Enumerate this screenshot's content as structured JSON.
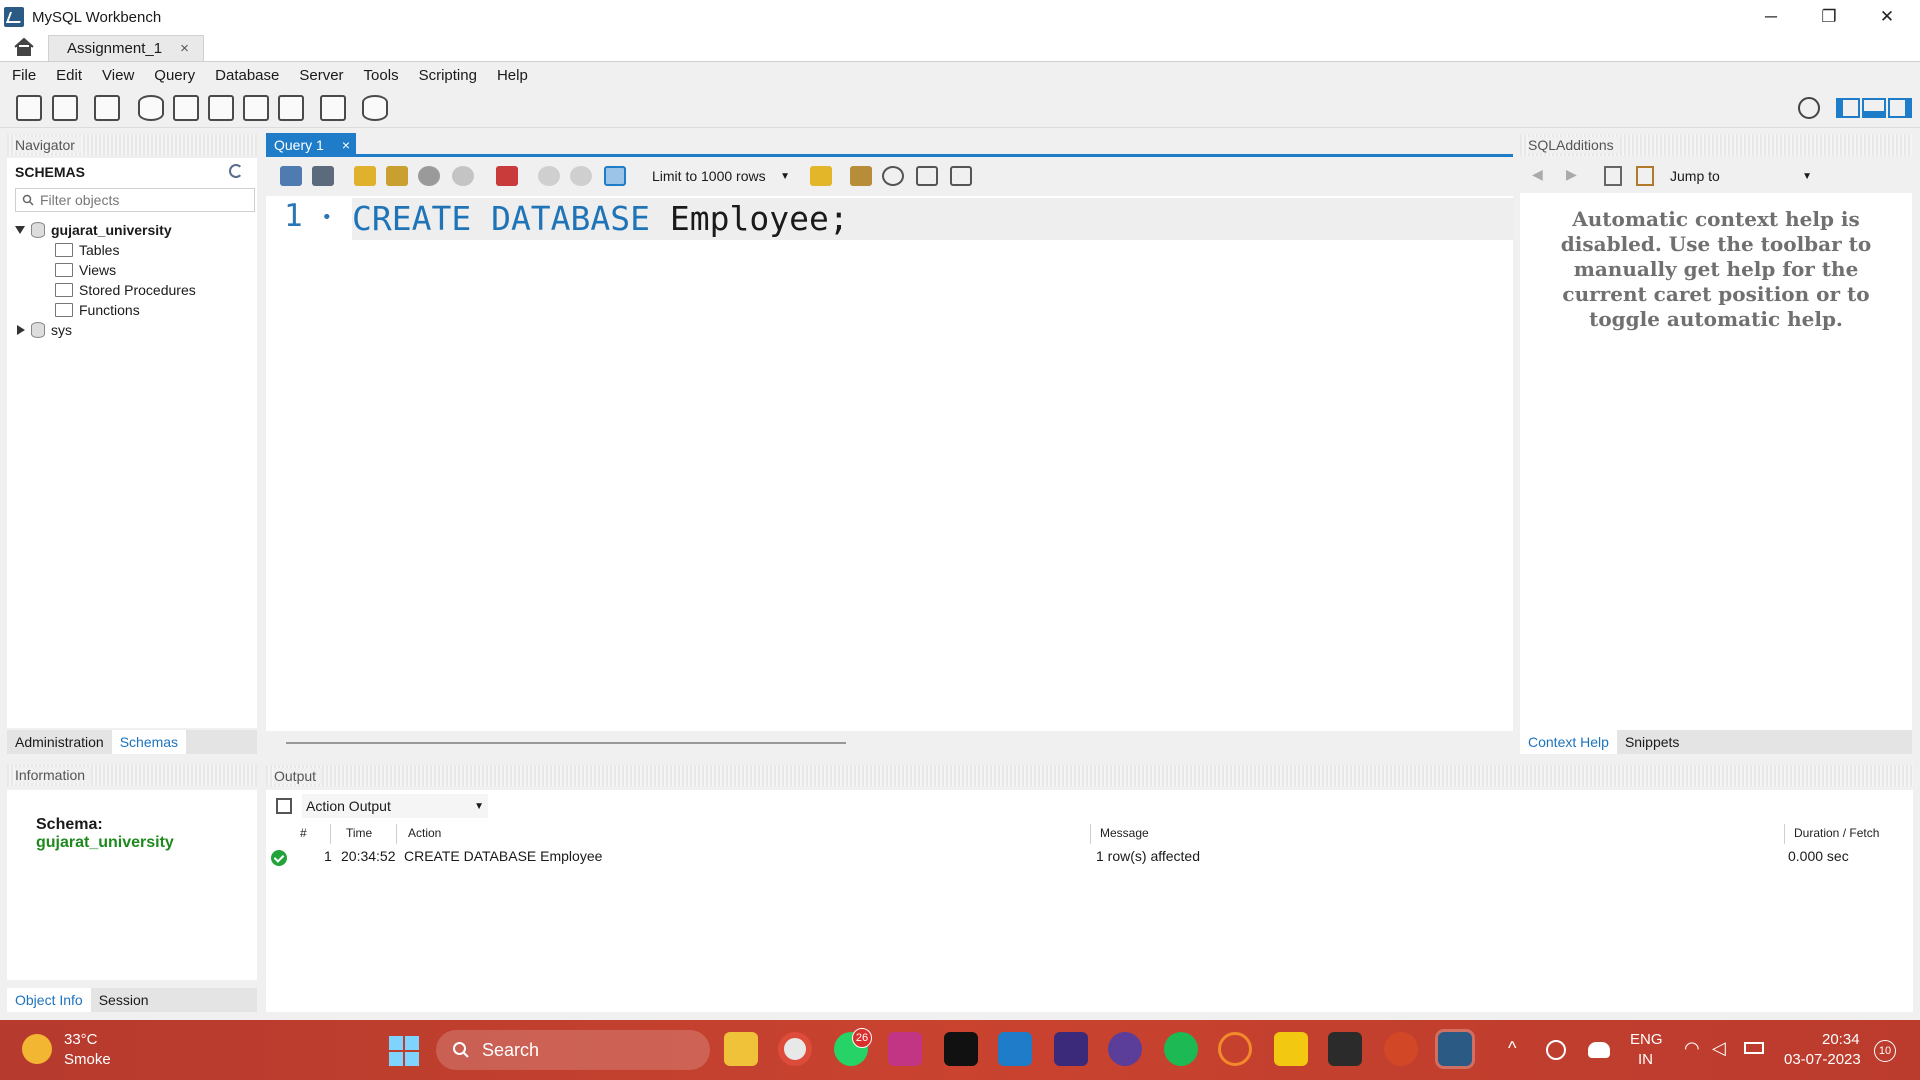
{
  "window": {
    "title": "MySQL Workbench",
    "minimize": "─",
    "restore": "❐",
    "close": "✕"
  },
  "doc_tab": {
    "label": "Assignment_1",
    "close": "×"
  },
  "menu": [
    "File",
    "Edit",
    "View",
    "Query",
    "Database",
    "Server",
    "Tools",
    "Scripting",
    "Help"
  ],
  "navigator": {
    "title": "Navigator",
    "schemas_label": "SCHEMAS",
    "filter_placeholder": "Filter objects",
    "schemas": [
      {
        "name": "gujarat_university",
        "expanded": true,
        "children": [
          "Tables",
          "Views",
          "Stored Procedures",
          "Functions"
        ]
      },
      {
        "name": "sys",
        "expanded": false
      }
    ],
    "tabs": [
      "Administration",
      "Schemas"
    ],
    "active_tab": "Schemas"
  },
  "information": {
    "title": "Information",
    "schema_label": "Schema:",
    "schema_value": "gujarat_university",
    "tabs": [
      "Object Info",
      "Session"
    ],
    "active_tab": "Object Info"
  },
  "query": {
    "tab_label": "Query 1",
    "tab_close": "×",
    "limit_label": "Limit to 1000 rows",
    "line_number": "1",
    "line_marker": "•",
    "code_keywords": "CREATE DATABASE",
    "code_rest": " Employee;"
  },
  "sql_additions": {
    "title": "SQLAdditions",
    "jump_to": "Jump to",
    "help_text": "Automatic context help is disabled. Use the toolbar to manually get help for the current caret position or to toggle automatic help.",
    "tabs": [
      "Context Help",
      "Snippets"
    ],
    "active_tab": "Context Help"
  },
  "output": {
    "title": "Output",
    "selector": "Action Output",
    "headers": {
      "num": "#",
      "time": "Time",
      "action": "Action",
      "message": "Message",
      "duration": "Duration / Fetch"
    },
    "rows": [
      {
        "num": "1",
        "time": "20:34:52",
        "action": "CREATE DATABASE Employee",
        "message": "1 row(s) affected",
        "duration": "0.000 sec",
        "status": "success"
      }
    ]
  },
  "taskbar": {
    "weather_temp": "33°C",
    "weather_desc": "Smoke",
    "search_label": "Search",
    "whatsapp_badge": "26",
    "lang_1": "ENG",
    "lang_2": "IN",
    "clock_time": "20:34",
    "clock_date": "03-07-2023",
    "notification_count": "10"
  },
  "colors": {
    "accent": "#1e7cc8",
    "keyword": "#1f74b8",
    "schema_green": "#1e8a1e",
    "taskbar": "#c9432f"
  }
}
